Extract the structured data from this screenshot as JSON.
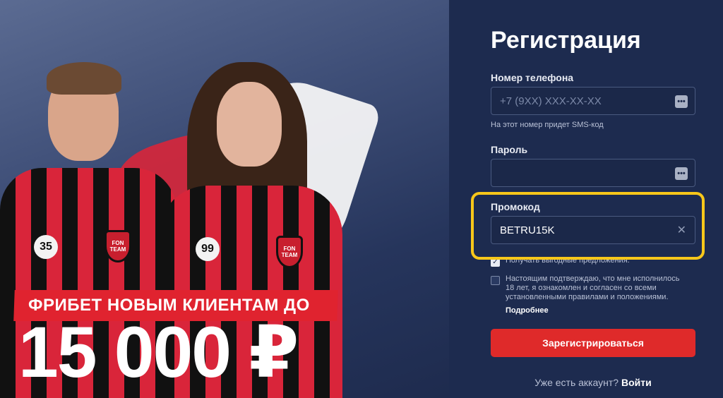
{
  "promo": {
    "headline": "ФРИБЕТ НОВЫМ КЛИЕНТАМ ДО",
    "amount": "15 000 ₽",
    "player1_number": "35",
    "player2_number": "99",
    "crest_text": "FON TEAM"
  },
  "form": {
    "title": "Регистрация",
    "phone": {
      "label": "Номер телефона",
      "placeholder": "+7 (9XX) XXX-XX-XX",
      "hint": "На этот номер придет SMS-код"
    },
    "password": {
      "label": "Пароль",
      "value": ""
    },
    "promo": {
      "label": "Промокод",
      "value": "BETRU15K"
    },
    "offers_check": {
      "checked": true,
      "text": "Получать выгодные предложения."
    },
    "age_check": {
      "checked": false,
      "text": "Настоящим подтверждаю, что мне исполнилось 18 лет, я ознакомлен и согласен со всеми установленными правилами и положениями.",
      "more": "Подробнее"
    },
    "submit_label": "Зарегистрироваться",
    "login_prompt": "Уже есть аккаунт?",
    "login_link": "Войти"
  },
  "colors": {
    "accent_red": "#df2a2a",
    "highlight_yellow": "#f7c71a",
    "panel_bg": "#1d2b4f"
  }
}
